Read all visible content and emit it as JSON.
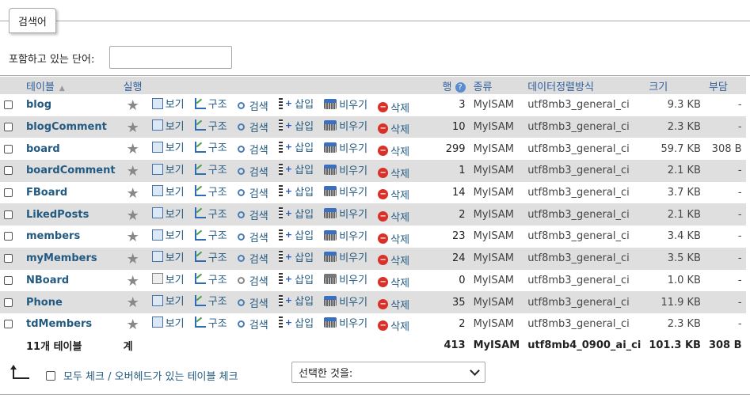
{
  "filter": {
    "legend": "검색어",
    "label": "포함하고 있는 단어:",
    "value": ""
  },
  "headers": {
    "table": "테이블",
    "action": "실행",
    "rows": "행",
    "type": "종류",
    "collation": "데이터정렬방식",
    "size": "크기",
    "overhead": "부담"
  },
  "actions": {
    "browse": "보기",
    "structure": "구조",
    "search": "검색",
    "insert": "삽입",
    "empty": "비우기",
    "drop": "삭제"
  },
  "tables": [
    {
      "name": "blog",
      "rows": "3",
      "engine": "MyISAM",
      "collation": "utf8mb3_general_ci",
      "size": "9.3 KB",
      "overhead": "-",
      "empty": false
    },
    {
      "name": "blogComment",
      "rows": "10",
      "engine": "MyISAM",
      "collation": "utf8mb3_general_ci",
      "size": "2.3 KB",
      "overhead": "-",
      "empty": false
    },
    {
      "name": "board",
      "rows": "299",
      "engine": "MyISAM",
      "collation": "utf8mb3_general_ci",
      "size": "59.7 KB",
      "overhead": "308 B",
      "empty": false
    },
    {
      "name": "boardComment",
      "rows": "1",
      "engine": "MyISAM",
      "collation": "utf8mb3_general_ci",
      "size": "2.1 KB",
      "overhead": "-",
      "empty": false
    },
    {
      "name": "FBoard",
      "rows": "14",
      "engine": "MyISAM",
      "collation": "utf8mb3_general_ci",
      "size": "3.7 KB",
      "overhead": "-",
      "empty": false
    },
    {
      "name": "LikedPosts",
      "rows": "2",
      "engine": "MyISAM",
      "collation": "utf8mb3_general_ci",
      "size": "2.1 KB",
      "overhead": "-",
      "empty": false
    },
    {
      "name": "members",
      "rows": "23",
      "engine": "MyISAM",
      "collation": "utf8mb3_general_ci",
      "size": "3.4 KB",
      "overhead": "-",
      "empty": false
    },
    {
      "name": "myMembers",
      "rows": "24",
      "engine": "MyISAM",
      "collation": "utf8mb3_general_ci",
      "size": "3.5 KB",
      "overhead": "-",
      "empty": false
    },
    {
      "name": "NBoard",
      "rows": "0",
      "engine": "MyISAM",
      "collation": "utf8mb3_general_ci",
      "size": "1.0 KB",
      "overhead": "-",
      "empty": true
    },
    {
      "name": "Phone",
      "rows": "35",
      "engine": "MyISAM",
      "collation": "utf8mb3_general_ci",
      "size": "11.9 KB",
      "overhead": "-",
      "empty": false
    },
    {
      "name": "tdMembers",
      "rows": "2",
      "engine": "MyISAM",
      "collation": "utf8mb3_general_ci",
      "size": "2.3 KB",
      "overhead": "-",
      "empty": false
    }
  ],
  "footer": {
    "count": "11개 테이블",
    "sum_label": "계",
    "rows": "413",
    "engine": "MyISAM",
    "collation": "utf8mb4_0900_ai_ci",
    "size": "101.3 KB",
    "overhead": "308 B"
  },
  "bottom": {
    "check_all": "모두 체크 / 오버헤드가 있는 테이블 체크",
    "select_placeholder": "선택한 것을:"
  }
}
